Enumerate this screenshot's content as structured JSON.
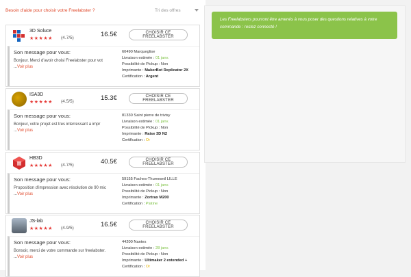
{
  "header": {
    "help_link": "Besoin d'aide pour choisir votre Freelabster ?",
    "sort_label": "Tri des offres"
  },
  "info": {
    "text": "Les Freelabsters pourront être amenés à vous poser des questions relatives à votre commande : restez connecté !"
  },
  "labels": {
    "choose": "CHOISIR CE FREELABSTER",
    "message_title": "Son message pour vous:",
    "see_more": "Voir plus",
    "dots": "...",
    "delivery": "Livraison estimée : ",
    "pickup": "Possibilité de Pickup : ",
    "printer": "Imprimante : ",
    "certification": "Certification : "
  },
  "offers": [
    {
      "name": "3D Soluce",
      "stars": "★★★★★",
      "rating": "(4.7/5)",
      "price": "16.5€",
      "message": "Bonjour. Merci d'avoir choisi Freelabster pour vot",
      "city": "60490 Marqueglise",
      "delivery": "01 janv.",
      "pickup": "Non",
      "printer": "MakerBot Replicator 2X",
      "certification": "Argent",
      "certification_color": "#222222"
    },
    {
      "name": "ISA3D",
      "stars": "★★★★★",
      "rating": "(4.5/5)",
      "price": "15.3€",
      "message": "Bonjour, votre projet est tres interressant a impr",
      "city": "81330 Saint pierre de trivisy",
      "delivery": "01 janv.",
      "pickup": "Non",
      "printer": "Raise 3D N2",
      "certification": "Or",
      "certification_color": "#e5b400"
    },
    {
      "name": "HB3D",
      "stars": "★★★★★",
      "rating": "(4.7/5)",
      "price": "40.5€",
      "message": "Proposition d'impression avec résolution de 90 mic",
      "city": "59155 Faches-Thumesnil LILLE",
      "delivery": "01 janv.",
      "pickup": "Non",
      "printer": "Zortrax M200",
      "certification": "Platine",
      "certification_color": "#7cc142"
    },
    {
      "name": "JS-lab",
      "stars": "★★★★★",
      "rating": "(4.9/5)",
      "price": "16.5€",
      "message": "Bonsoir, merci de votre commande sur freelabster.",
      "city": "44200 Nantes",
      "delivery": "28 janv.",
      "pickup": "Non",
      "printer": "Ultimaker 2 extended +",
      "certification": "Or",
      "certification_color": "#e5b400"
    }
  ]
}
